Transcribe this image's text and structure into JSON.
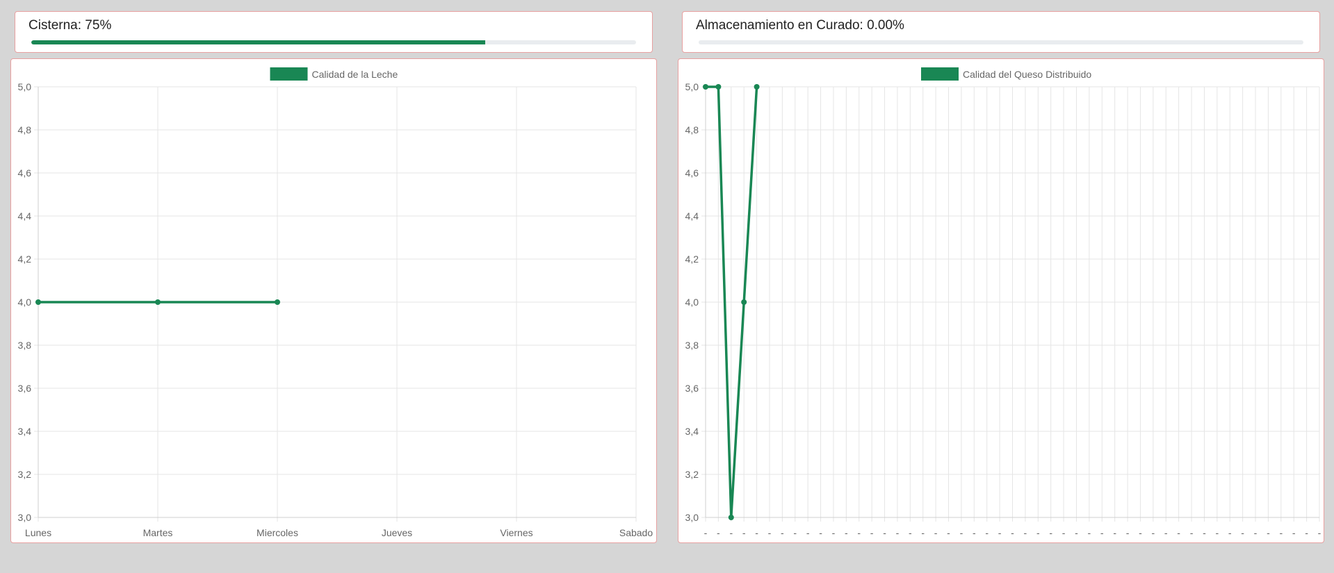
{
  "status": {
    "cistern": {
      "label": "Cisterna: 75%",
      "fraction": 0.75
    },
    "curing": {
      "label": "Almacenamiento en Curado: 0.00%",
      "fraction": 0.0
    }
  },
  "colors": {
    "accent": "#198754",
    "card_border": "#e8a0a0",
    "background": "#d6d6d6",
    "grid": "#e5e5e5",
    "track": "#e9ecef"
  },
  "chart_data": [
    {
      "type": "line",
      "title": "",
      "legend": "Calidad de la Leche",
      "legend_position": "top-center",
      "categories": [
        "Lunes",
        "Martes",
        "Miercoles",
        "Jueves",
        "Viernes",
        "Sabado"
      ],
      "values": [
        4.0,
        4.0,
        4.0
      ],
      "ylim": [
        3.0,
        5.0
      ],
      "yticks": [
        "3,0",
        "3,2",
        "3,4",
        "3,6",
        "3,8",
        "4,0",
        "4,2",
        "4,4",
        "4,6",
        "4,8",
        "5,0"
      ],
      "grid": true
    },
    {
      "type": "line",
      "title": "",
      "legend": "Calidad del Queso Distribuido",
      "legend_position": "top-center",
      "category_count": 49,
      "category_label": "-",
      "values": [
        5.0,
        5.0,
        3.0,
        4.0,
        5.0
      ],
      "ylim": [
        3.0,
        5.0
      ],
      "yticks": [
        "3,0",
        "3,2",
        "3,4",
        "3,6",
        "3,8",
        "4,0",
        "4,2",
        "4,4",
        "4,6",
        "4,8",
        "5,0"
      ],
      "grid": true
    }
  ]
}
